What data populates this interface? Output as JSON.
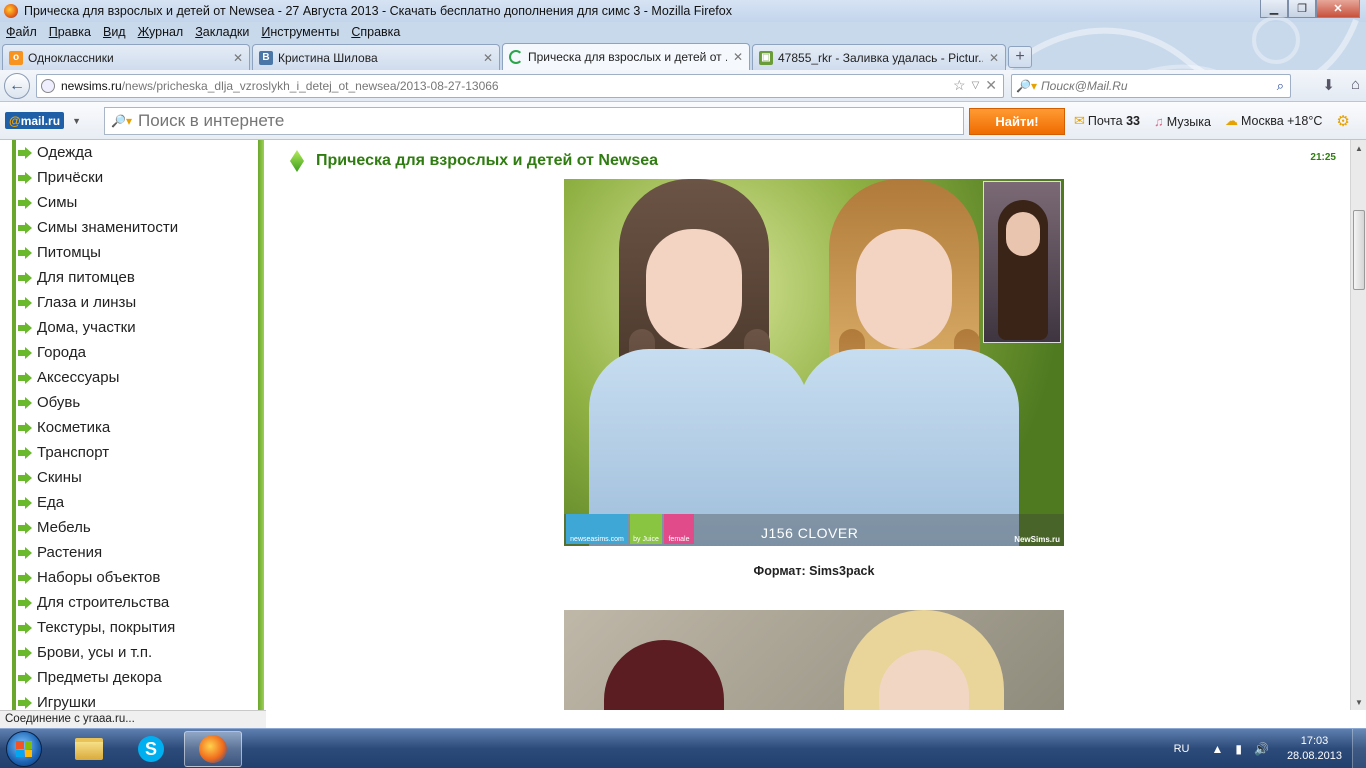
{
  "window": {
    "title": "Прическа для взрослых и детей от Newsea - 27 Августа 2013 - Скачать бесплатно дополнения для симс 3 - Mozilla Firefox"
  },
  "menu": [
    "Файл",
    "Правка",
    "Вид",
    "Журнал",
    "Закладки",
    "Инструменты",
    "Справка"
  ],
  "tabs": [
    {
      "label": "Одноклассники",
      "icon": "odnoklassniki-icon",
      "color": "#f7931e"
    },
    {
      "label": "Кристина Шилова",
      "icon": "vk-icon",
      "color": "#4a76a8"
    },
    {
      "label": "Прическа для взрослых и детей от ...",
      "icon": "loading-icon",
      "color": "#2aa54a",
      "active": true
    },
    {
      "label": "47855_rkr - Заливка удалась - Pictur...",
      "icon": "image-icon",
      "color": "#6b9c3a"
    }
  ],
  "address": {
    "domain": "newsims.ru",
    "path": "/news/pricheska_dlja_vzroslykh_i_detej_ot_newsea/2013-08-27-13066"
  },
  "search": {
    "placeholder": "Поиск@Mail.Ru"
  },
  "mailru": {
    "logo": "@mail.ru",
    "search_placeholder": "Поиск в интернете",
    "find_button": "Найти!",
    "mail_label": "Почта",
    "mail_count": "33",
    "music_label": "Музыка",
    "weather_label": "Москва +18°C"
  },
  "sidebar": {
    "categories": [
      "Одежда",
      "Причёски",
      "Симы",
      "Симы знаменитости",
      "Питомцы",
      "Для питомцев",
      "Глаза и линзы",
      "Дома, участки",
      "Города",
      "Аксессуары",
      "Обувь",
      "Косметика",
      "Транспорт",
      "Скины",
      "Еда",
      "Мебель",
      "Растения",
      "Наборы объектов",
      "Для строительства",
      "Текстуры, покрытия",
      "Брови, усы и т.п.",
      "Предметы декора",
      "Игрушки"
    ]
  },
  "post": {
    "title": "Прическа для взрослых и детей от Newsea",
    "time": "21:25",
    "image_caption": "J156 CLOVER",
    "image_badges": [
      "newseasims.com",
      "by Juice",
      "female"
    ],
    "image_watermark": "NewSims.ru",
    "format_label": "Формат: Sims3pack"
  },
  "status": {
    "text": "Соединение с yraaa.ru..."
  },
  "taskbar": {
    "lang": "RU",
    "time": "17:03",
    "date": "28.08.2013"
  },
  "colors": {
    "accent_green": "#2f7d10",
    "sidebar_border": "#6aa62b",
    "find_button": "#ef6c00",
    "mailru_blue": "#1f5fa8"
  }
}
